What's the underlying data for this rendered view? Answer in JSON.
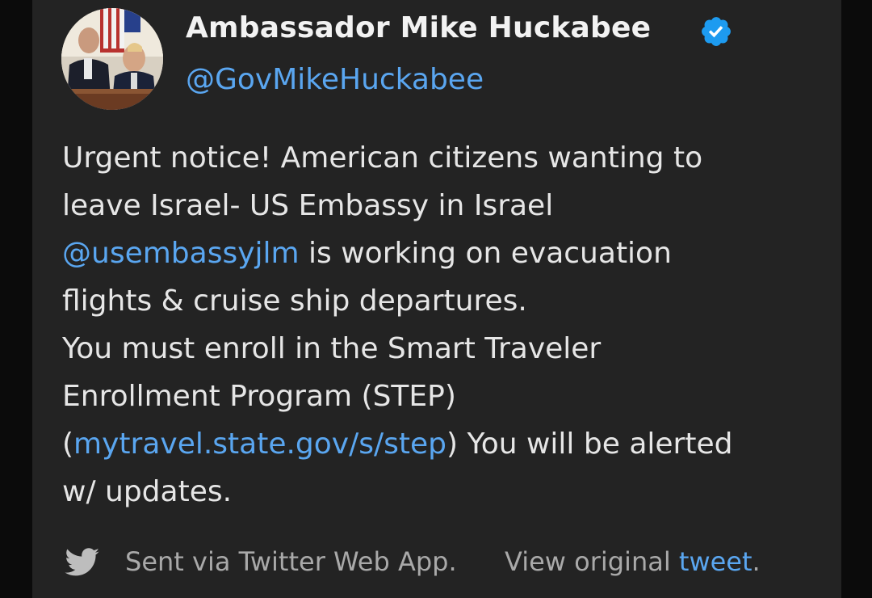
{
  "author": {
    "name": "Ambassador Mike Huckabee",
    "handle": "@GovMikeHuckabee",
    "verified_icon": "verified-badge-icon",
    "verified_color": "#1d9bf0"
  },
  "tweet": {
    "line1": "Urgent notice! American citizens wanting to",
    "line2": "leave Israel- US Embassy in Israel",
    "mention": "@usembassyjlm",
    "line3_rest": " is working on evacuation",
    "line4": "flights & cruise ship departures.",
    "line5": "You must enroll in the Smart Traveler",
    "line6": "Enrollment Program (STEP)",
    "paren_open": "(",
    "link": "mytravel.state.gov/s/step",
    "line7_rest": ") You will be alerted",
    "line8": "w/ updates."
  },
  "footer": {
    "icon": "twitter-bird-icon",
    "sent_via": "Sent via Twitter Web App.",
    "view_original_prefix": "View original ",
    "tweet_link": "tweet",
    "suffix": "."
  },
  "colors": {
    "background": "#232323",
    "text": "#e6e6e6",
    "link": "#5aa6f0",
    "muted": "#a9a9a9"
  }
}
